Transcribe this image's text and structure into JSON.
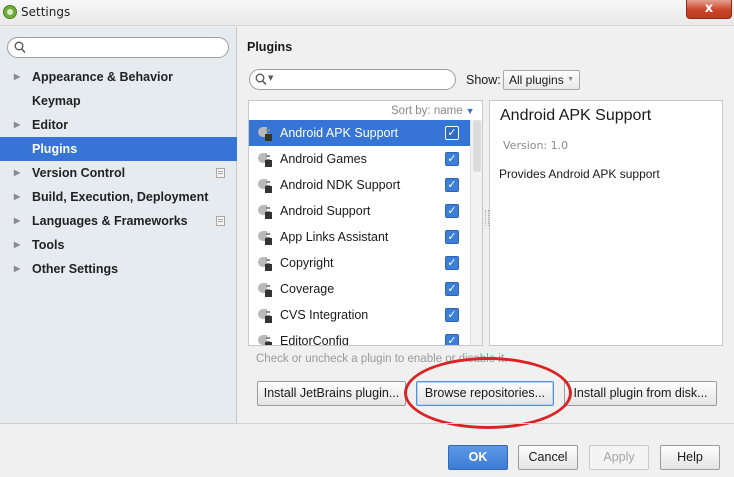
{
  "window": {
    "title": "Settings",
    "close_label": "x"
  },
  "nav": {
    "search_placeholder": "",
    "items": [
      {
        "label": "Appearance & Behavior",
        "has_arrow": true
      },
      {
        "label": "Keymap",
        "has_arrow": false
      },
      {
        "label": "Editor",
        "has_arrow": true
      },
      {
        "label": "Plugins",
        "has_arrow": false,
        "selected": true
      },
      {
        "label": "Version Control",
        "has_arrow": true,
        "project_icon": true
      },
      {
        "label": "Build, Execution, Deployment",
        "has_arrow": true
      },
      {
        "label": "Languages & Frameworks",
        "has_arrow": true,
        "project_icon": true
      },
      {
        "label": "Tools",
        "has_arrow": true
      },
      {
        "label": "Other Settings",
        "has_arrow": true
      }
    ]
  },
  "plugins_page": {
    "heading": "Plugins",
    "search_placeholder": "",
    "show_label": "Show:",
    "show_value": "All plugins",
    "sort_label": "Sort by: name",
    "list": [
      {
        "name": "Android APK Support",
        "checked": true,
        "selected": true
      },
      {
        "name": "Android Games",
        "checked": true
      },
      {
        "name": "Android NDK Support",
        "checked": true
      },
      {
        "name": "Android Support",
        "checked": true
      },
      {
        "name": "App Links Assistant",
        "checked": true
      },
      {
        "name": "Copyright",
        "checked": true
      },
      {
        "name": "Coverage",
        "checked": true
      },
      {
        "name": "CVS Integration",
        "checked": true
      },
      {
        "name": "EditorConfig",
        "checked": true
      }
    ],
    "detail": {
      "title": "Android APK Support",
      "version": "Version: 1.0",
      "description": "Provides Android APK support"
    },
    "hint": "Check or uncheck a plugin to enable or disable it.",
    "buttons": {
      "install_jetbrains": "Install JetBrains plugin...",
      "browse_repositories": "Browse repositories...",
      "install_from_disk": "Install plugin from disk..."
    }
  },
  "footer": {
    "ok": "OK",
    "cancel": "Cancel",
    "apply": "Apply",
    "help": "Help"
  },
  "colors": {
    "accent": "#3675d6",
    "annotation_circle": "#d92425"
  }
}
